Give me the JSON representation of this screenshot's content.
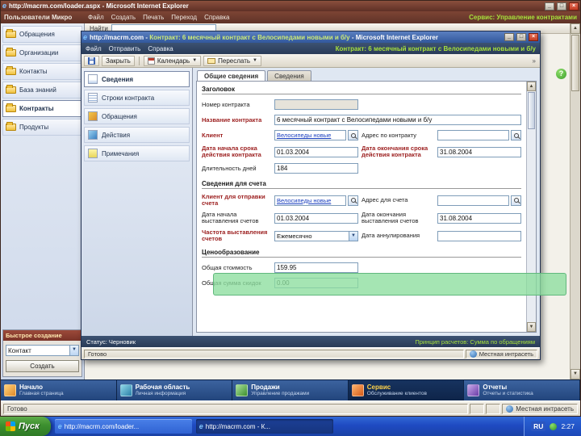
{
  "main_window": {
    "title": "http://macrm.com/loader.aspx - Microsoft Internet Explorer",
    "controls": {
      "minimize": "_",
      "maximize": "□",
      "close": "×"
    },
    "header": {
      "org": "Пользователи Микро",
      "menu": [
        "Файл",
        "Создать",
        "Печать",
        "Переход",
        "Справка"
      ],
      "area": "Сервис: Управление контрактами"
    },
    "toolbar": {
      "find_label": "Найти"
    },
    "help_badge": "?",
    "sidebar": {
      "items": [
        "Обращения",
        "Организации",
        "Контакты",
        "База знаний",
        "Контракты",
        "Продукты"
      ],
      "selected": "Контракты"
    },
    "quick_create": {
      "title": "Быстрое создание",
      "value": "Контакт",
      "button": "Создать"
    },
    "bottom_nav": [
      {
        "title": "Начало",
        "subtitle": "Главная страница"
      },
      {
        "title": "Рабочая область",
        "subtitle": "Личная информация"
      },
      {
        "title": "Продажи",
        "subtitle": "Управление продажами"
      },
      {
        "title": "Сервис",
        "subtitle": "Обслуживание клиентов"
      },
      {
        "title": "Отчеты",
        "subtitle": "Отчеты и статистика"
      }
    ],
    "status": {
      "left": "Готово",
      "right": "Местная интрасеть"
    }
  },
  "dialog": {
    "title": {
      "prefix": "http://macrm.com - ",
      "highlight": "Контракт: 6 месячный контракт с Велосипедами новыми и б/у",
      "suffix": " - Microsoft Internet Explorer"
    },
    "controls": {
      "minimize": "_",
      "maximize": "□",
      "close": "×"
    },
    "menu": [
      "Файл",
      "Отправить",
      "Справка"
    ],
    "form_title": "Контракт: 6 месячный контракт с Велосипедами новыми и б/у",
    "toolbar": {
      "close": "Закрыть",
      "calendar": "Календарь",
      "forward": "Переслать",
      "more": "»"
    },
    "nav": [
      "Сведения",
      "Строки контракта",
      "Обращения",
      "Действия",
      "Примечания"
    ],
    "tabs": [
      "Общие сведения",
      "Сведения"
    ],
    "sections": {
      "header": "Заголовок",
      "billing": "Сведения для счета",
      "pricing": "Ценообразование"
    },
    "fields": {
      "number": {
        "label": "Номер контракта",
        "value": ""
      },
      "name": {
        "label": "Название контракта",
        "value": "6 месячный контракт с Велосипедами новыми и б/у"
      },
      "customer": {
        "label": "Клиент",
        "value": "Велосипеды новые"
      },
      "address": {
        "label": "Адрес по контракту",
        "value": ""
      },
      "start": {
        "label": "Дата начала срока действия контракта",
        "value": "01.03.2004"
      },
      "end": {
        "label": "Дата окончания срока действия контракта",
        "value": "31.08.2004"
      },
      "duration": {
        "label": "Длительность дней",
        "value": "184"
      },
      "bill_customer": {
        "label": "Клиент для отправки счета",
        "value": "Велосипеды новые"
      },
      "bill_address": {
        "label": "Адрес для счета",
        "value": ""
      },
      "bill_start": {
        "label": "Дата начала выставления счетов",
        "value": "01.03.2004"
      },
      "bill_end": {
        "label": "Дата окончания выставления счетов",
        "value": "31.08.2004"
      },
      "frequency": {
        "label": "Частота выставления счетов",
        "value": "Ежемесячно"
      },
      "cancel": {
        "label": "Дата аннулирования",
        "value": ""
      },
      "total": {
        "label": "Общая стоимость",
        "value": "159.95"
      },
      "discount": {
        "label": "Общая сумма скидок",
        "value": "0.00"
      }
    },
    "status": {
      "left": "Статус: Черновик",
      "right": "Принцип расчетов: Сумма по обращениям"
    },
    "ie_status": {
      "left": "Готово",
      "right": "Местная интрасеть"
    }
  },
  "taskbar": {
    "start": "Пуск",
    "windows": [
      "http://macrm.com/loader...",
      "http://macrm.com - К..."
    ],
    "tray": {
      "lang": "RU",
      "time": "2:27"
    }
  },
  "colors": {
    "accent_green": "#a8e23c",
    "highlight_overlay": "#8cde9e",
    "titlebar_main": "#6e3a2c",
    "titlebar_dialog": "#4470ae"
  }
}
